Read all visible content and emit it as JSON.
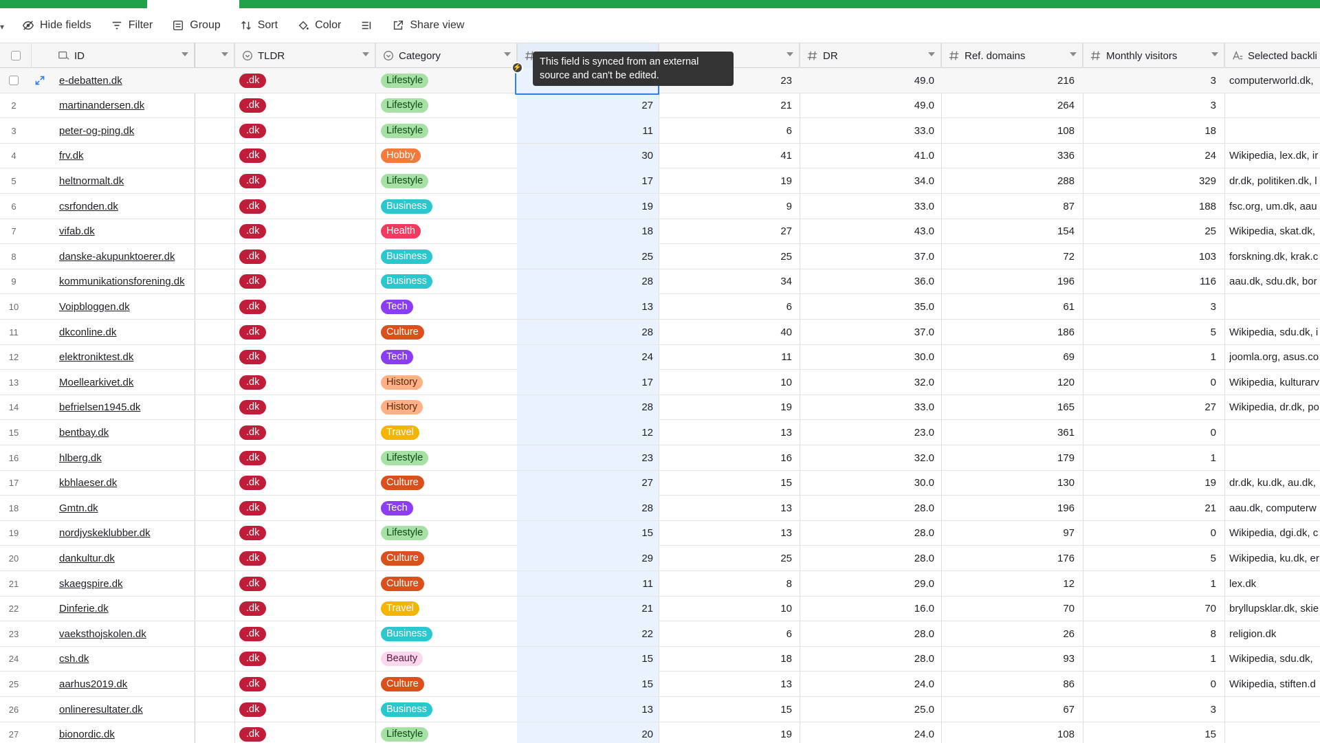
{
  "toolbar": {
    "hide_fields": "Hide fields",
    "filter": "Filter",
    "group": "Group",
    "sort": "Sort",
    "color": "Color",
    "share_view": "Share view"
  },
  "columns": {
    "id": "ID",
    "tldr": "TLDR",
    "category": "Category",
    "dr": "DR",
    "ref_domains": "Ref. domains",
    "monthly_visitors": "Monthly visitors",
    "selected_backlinks": "Selected backli"
  },
  "tooltip": "This field is synced from an external source and can't be edited.",
  "category_colors": {
    "Lifestyle": {
      "bg": "#a7e0a4",
      "fg": "#0c4a16"
    },
    "Hobby": {
      "bg": "#f4793a",
      "fg": "#ffffff"
    },
    "Business": {
      "bg": "#2bc7cf",
      "fg": "#ffffff"
    },
    "Health": {
      "bg": "#f03a5e",
      "fg": "#ffffff"
    },
    "Tech": {
      "bg": "#8a3df2",
      "fg": "#ffffff"
    },
    "Culture": {
      "bg": "#d9501d",
      "fg": "#ffffff"
    },
    "History": {
      "bg": "#ffb084",
      "fg": "#5a2a0b"
    },
    "Travel": {
      "bg": "#f4b400",
      "fg": "#ffffff"
    },
    "Beauty": {
      "bg": "#fbd7ee",
      "fg": "#5b1640"
    }
  },
  "rows": [
    {
      "n": "",
      "id": "e-debatten.dk",
      "tld": ".dk",
      "cat": "Lifestyle",
      "a": "",
      "b": "23",
      "dr": "49.0",
      "ref": "216",
      "mv": "3",
      "bl": "computerworld.dk,"
    },
    {
      "n": "2",
      "id": "martinandersen.dk",
      "tld": ".dk",
      "cat": "Lifestyle",
      "a": "27",
      "b": "21",
      "dr": "49.0",
      "ref": "264",
      "mv": "3",
      "bl": ""
    },
    {
      "n": "3",
      "id": "peter-og-ping.dk",
      "tld": ".dk",
      "cat": "Lifestyle",
      "a": "11",
      "b": "6",
      "dr": "33.0",
      "ref": "108",
      "mv": "18",
      "bl": ""
    },
    {
      "n": "4",
      "id": "frv.dk",
      "tld": ".dk",
      "cat": "Hobby",
      "a": "30",
      "b": "41",
      "dr": "41.0",
      "ref": "336",
      "mv": "24",
      "bl": "Wikipedia, lex.dk, ir"
    },
    {
      "n": "5",
      "id": "heltnormalt.dk",
      "tld": ".dk",
      "cat": "Lifestyle",
      "a": "17",
      "b": "19",
      "dr": "34.0",
      "ref": "288",
      "mv": "329",
      "bl": "dr.dk, politiken.dk, l"
    },
    {
      "n": "6",
      "id": "csrfonden.dk",
      "tld": ".dk",
      "cat": "Business",
      "a": "19",
      "b": "9",
      "dr": "33.0",
      "ref": "87",
      "mv": "188",
      "bl": "fsc.org, um.dk, aau"
    },
    {
      "n": "7",
      "id": "vifab.dk",
      "tld": ".dk",
      "cat": "Health",
      "a": "18",
      "b": "27",
      "dr": "43.0",
      "ref": "154",
      "mv": "25",
      "bl": "Wikipedia, skat.dk,"
    },
    {
      "n": "8",
      "id": "danske-akupunktoerer.dk",
      "tld": ".dk",
      "cat": "Business",
      "a": "25",
      "b": "25",
      "dr": "37.0",
      "ref": "72",
      "mv": "103",
      "bl": "forskning.dk, krak.c"
    },
    {
      "n": "9",
      "id": "kommunikationsforening.dk",
      "tld": ".dk",
      "cat": "Business",
      "a": "28",
      "b": "34",
      "dr": "36.0",
      "ref": "196",
      "mv": "116",
      "bl": "aau.dk, sdu.dk, bor"
    },
    {
      "n": "10",
      "id": "Voipbloggen.dk",
      "tld": ".dk",
      "cat": "Tech",
      "a": "13",
      "b": "6",
      "dr": "35.0",
      "ref": "61",
      "mv": "3",
      "bl": ""
    },
    {
      "n": "11",
      "id": "dkconline.dk",
      "tld": ".dk",
      "cat": "Culture",
      "a": "28",
      "b": "40",
      "dr": "37.0",
      "ref": "186",
      "mv": "5",
      "bl": "Wikipedia, sdu.dk, i"
    },
    {
      "n": "12",
      "id": "elektroniktest.dk",
      "tld": ".dk",
      "cat": "Tech",
      "a": "24",
      "b": "11",
      "dr": "30.0",
      "ref": "69",
      "mv": "1",
      "bl": "joomla.org, asus.co"
    },
    {
      "n": "13",
      "id": "Moellearkivet.dk",
      "tld": ".dk",
      "cat": "History",
      "a": "17",
      "b": "10",
      "dr": "32.0",
      "ref": "120",
      "mv": "0",
      "bl": "Wikipedia, kulturarv"
    },
    {
      "n": "14",
      "id": "befrielsen1945.dk",
      "tld": ".dk",
      "cat": "History",
      "a": "28",
      "b": "19",
      "dr": "33.0",
      "ref": "165",
      "mv": "27",
      "bl": "Wikipedia, dr.dk, po"
    },
    {
      "n": "15",
      "id": "bentbay.dk",
      "tld": ".dk",
      "cat": "Travel",
      "a": "12",
      "b": "13",
      "dr": "23.0",
      "ref": "361",
      "mv": "0",
      "bl": ""
    },
    {
      "n": "16",
      "id": "hlberg.dk",
      "tld": ".dk",
      "cat": "Lifestyle",
      "a": "23",
      "b": "16",
      "dr": "32.0",
      "ref": "179",
      "mv": "1",
      "bl": ""
    },
    {
      "n": "17",
      "id": "kbhlaeser.dk",
      "tld": ".dk",
      "cat": "Culture",
      "a": "27",
      "b": "15",
      "dr": "30.0",
      "ref": "130",
      "mv": "19",
      "bl": "dr.dk, ku.dk, au.dk,"
    },
    {
      "n": "18",
      "id": "Gmtn.dk",
      "tld": ".dk",
      "cat": "Tech",
      "a": "28",
      "b": "13",
      "dr": "28.0",
      "ref": "196",
      "mv": "21",
      "bl": "aau.dk, computerw"
    },
    {
      "n": "19",
      "id": "nordjyskeklubber.dk",
      "tld": ".dk",
      "cat": "Lifestyle",
      "a": "15",
      "b": "13",
      "dr": "28.0",
      "ref": "97",
      "mv": "0",
      "bl": "Wikipedia, dgi.dk, c"
    },
    {
      "n": "20",
      "id": "dankultur.dk",
      "tld": ".dk",
      "cat": "Culture",
      "a": "29",
      "b": "25",
      "dr": "28.0",
      "ref": "176",
      "mv": "5",
      "bl": "Wikipedia, ku.dk, er"
    },
    {
      "n": "21",
      "id": "skaegspire.dk",
      "tld": ".dk",
      "cat": "Culture",
      "a": "11",
      "b": "8",
      "dr": "29.0",
      "ref": "12",
      "mv": "1",
      "bl": "lex.dk"
    },
    {
      "n": "22",
      "id": "Dinferie.dk",
      "tld": ".dk",
      "cat": "Travel",
      "a": "21",
      "b": "10",
      "dr": "16.0",
      "ref": "70",
      "mv": "70",
      "bl": "bryllupsklar.dk, skie"
    },
    {
      "n": "23",
      "id": "vaeksthojskolen.dk",
      "tld": ".dk",
      "cat": "Business",
      "a": "22",
      "b": "6",
      "dr": "28.0",
      "ref": "26",
      "mv": "8",
      "bl": "religion.dk"
    },
    {
      "n": "24",
      "id": "csh.dk",
      "tld": ".dk",
      "cat": "Beauty",
      "a": "15",
      "b": "18",
      "dr": "28.0",
      "ref": "93",
      "mv": "1",
      "bl": "Wikipedia, sdu.dk,"
    },
    {
      "n": "25",
      "id": "aarhus2019.dk",
      "tld": ".dk",
      "cat": "Culture",
      "a": "15",
      "b": "13",
      "dr": "24.0",
      "ref": "86",
      "mv": "0",
      "bl": "Wikipedia, stiften.d"
    },
    {
      "n": "26",
      "id": "onlineresultater.dk",
      "tld": ".dk",
      "cat": "Business",
      "a": "13",
      "b": "15",
      "dr": "25.0",
      "ref": "67",
      "mv": "3",
      "bl": ""
    },
    {
      "n": "27",
      "id": "bionordic.dk",
      "tld": ".dk",
      "cat": "Lifestyle",
      "a": "20",
      "b": "19",
      "dr": "24.0",
      "ref": "108",
      "mv": "15",
      "bl": ""
    }
  ]
}
